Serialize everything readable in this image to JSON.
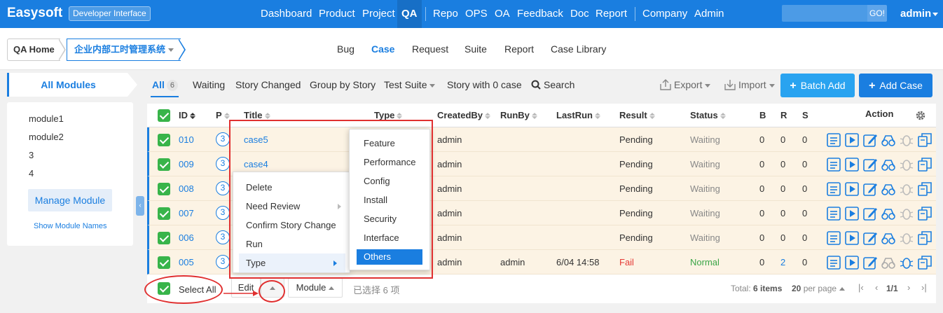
{
  "colors": {
    "primary": "#1a7ee0",
    "annotation": "#e03030",
    "success": "#38b44a",
    "row_bg": "#fcf3e4",
    "fail": "#e53935"
  },
  "topnav": {
    "brand": "Easysoft",
    "badge": "Developer Interface",
    "items": [
      "Dashboard",
      "Product",
      "Project",
      "QA",
      "Repo",
      "OPS",
      "OA",
      "Feedback",
      "Doc",
      "Report",
      "Company",
      "Admin"
    ],
    "active": "QA",
    "search_button": "GO!",
    "user": "admin"
  },
  "breadcrumb": {
    "home": "QA Home",
    "product": "企业内部工时管理系统"
  },
  "subnav": {
    "items": [
      "Bug",
      "Case",
      "Request",
      "Suite",
      "Report",
      "Case Library"
    ],
    "active": "Case"
  },
  "sidebar": {
    "title": "All Modules",
    "modules": [
      "module1",
      "module2",
      "3",
      "4"
    ],
    "manage_button": "Manage Module",
    "show_names": "Show Module Names"
  },
  "filters": {
    "all": "All",
    "all_count": "6",
    "waiting": "Waiting",
    "story_changed": "Story Changed",
    "group_by_story": "Group by Story",
    "test_suite": "Test Suite",
    "story_zero": "Story with 0 case",
    "search": "Search"
  },
  "toolbar": {
    "export": "Export",
    "import": "Import",
    "batch_add": "Batch Add",
    "add_case": "Add Case"
  },
  "table": {
    "columns": [
      "ID",
      "P",
      "Title",
      "Type",
      "CreatedBy",
      "RunBy",
      "LastRun",
      "Result",
      "Status",
      "B",
      "R",
      "S",
      "Action"
    ],
    "rows": [
      {
        "id": "010",
        "p": "3",
        "title": "case5",
        "created_by": "admin",
        "run_by": "",
        "last_run": "",
        "result": "Pending",
        "status": "Waiting",
        "b": "0",
        "r": "0",
        "s": "0"
      },
      {
        "id": "009",
        "p": "3",
        "title": "case4",
        "created_by": "admin",
        "run_by": "",
        "last_run": "",
        "result": "Pending",
        "status": "Waiting",
        "b": "0",
        "r": "0",
        "s": "0"
      },
      {
        "id": "008",
        "p": "3",
        "title": "",
        "created_by": "admin",
        "run_by": "",
        "last_run": "",
        "result": "Pending",
        "status": "Waiting",
        "b": "0",
        "r": "0",
        "s": "0"
      },
      {
        "id": "007",
        "p": "3",
        "title": "",
        "created_by": "admin",
        "run_by": "",
        "last_run": "",
        "result": "Pending",
        "status": "Waiting",
        "b": "0",
        "r": "0",
        "s": "0"
      },
      {
        "id": "006",
        "p": "3",
        "title": "",
        "created_by": "admin",
        "run_by": "",
        "last_run": "",
        "result": "Pending",
        "status": "Waiting",
        "b": "0",
        "r": "0",
        "s": "0"
      },
      {
        "id": "005",
        "p": "3",
        "title": "",
        "created_by": "admin",
        "run_by": "admin",
        "last_run": "6/04 14:58",
        "result": "Fail",
        "status": "Normal",
        "b": "0",
        "r": "2",
        "s": "0"
      }
    ]
  },
  "footer": {
    "select_all": "Select All",
    "edit": "Edit",
    "module": "Module",
    "selected": "已选择 6 项",
    "total_label": "Total:",
    "total": "6 items",
    "per_page": "20",
    "per_page_label": "per page",
    "page": "1/1"
  },
  "batch_menu": {
    "items": [
      "Delete",
      "Need Review",
      "Confirm Story Change",
      "Run",
      "Type"
    ],
    "type_submenu": [
      "Feature",
      "Performance",
      "Config",
      "Install",
      "Security",
      "Interface",
      "Others"
    ],
    "selected_type": "Others"
  }
}
